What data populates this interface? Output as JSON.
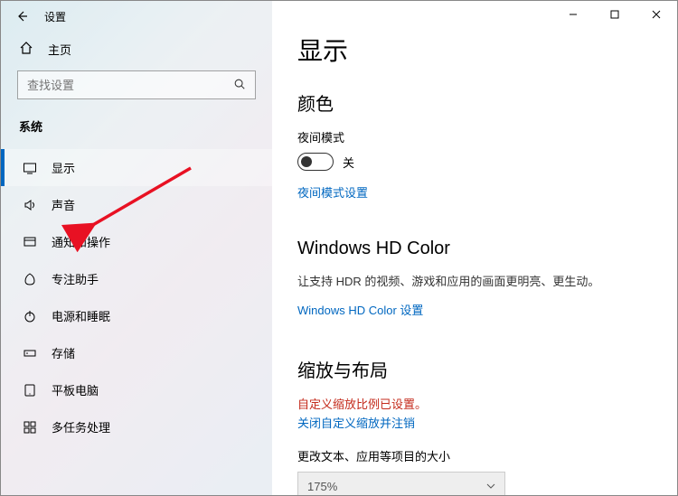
{
  "titlebar": {
    "app_title": "设置"
  },
  "sidebar": {
    "home_label": "主页",
    "search_placeholder": "查找设置",
    "category_label": "系统",
    "items": [
      {
        "label": "显示"
      },
      {
        "label": "声音"
      },
      {
        "label": "通知和操作"
      },
      {
        "label": "专注助手"
      },
      {
        "label": "电源和睡眠"
      },
      {
        "label": "存储"
      },
      {
        "label": "平板电脑"
      },
      {
        "label": "多任务处理"
      }
    ]
  },
  "main": {
    "page_title": "显示",
    "color_heading": "颜色",
    "night_light_label": "夜间模式",
    "night_light_state": "关",
    "night_light_link": "夜间模式设置",
    "hd_color_heading": "Windows HD Color",
    "hd_color_desc": "让支持 HDR 的视频、游戏和应用的画面更明亮、更生动。",
    "hd_color_link": "Windows HD Color 设置",
    "scale_heading": "缩放与布局",
    "scale_warning": "自定义缩放比例已设置。",
    "scale_turnoff_link": "关闭自定义缩放并注销",
    "scale_text_label": "更改文本、应用等项目的大小",
    "scale_value": "175%"
  }
}
